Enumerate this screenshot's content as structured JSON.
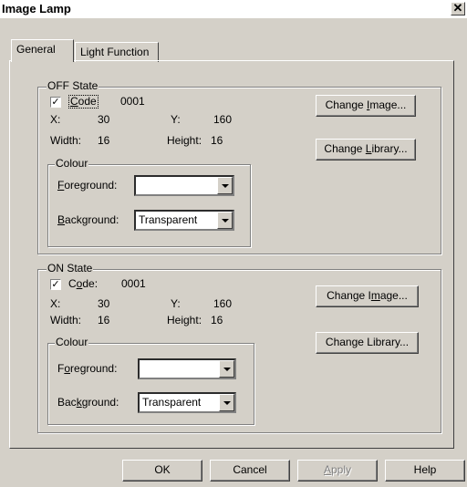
{
  "window": {
    "title": "Image Lamp",
    "close_symbol": "✕"
  },
  "tabs": [
    {
      "label": "General"
    },
    {
      "label": "Light Function"
    }
  ],
  "off_state": {
    "legend": "OFF State",
    "code_label": "Code",
    "code_checked": true,
    "code_value": "0001",
    "x_label": "X:",
    "x_value": "30",
    "y_label": "Y:",
    "y_value": "160",
    "width_label": "Width:",
    "width_value": "16",
    "height_label": "Height:",
    "height_value": "16",
    "colour": {
      "legend": "Colour",
      "foreground_label": "Foreground:",
      "foreground_value": "",
      "background_label": "Background:",
      "background_value": "Transparent"
    },
    "change_image": "Change Image...",
    "change_library": "Change Library..."
  },
  "on_state": {
    "legend": "ON State",
    "code_label": "Code:",
    "code_checked": true,
    "code_value": "0001",
    "x_label": "X:",
    "x_value": "30",
    "y_label": "Y:",
    "y_value": "160",
    "width_label": "Width:",
    "width_value": "16",
    "height_label": "Height:",
    "height_value": "16",
    "colour": {
      "legend": "Colour",
      "foreground_label": "Foreground:",
      "foreground_value": "",
      "background_label": "Background:",
      "background_value": "Transparent"
    },
    "change_image": "Change Image...",
    "change_library": "Change Library..."
  },
  "buttons": {
    "ok": "OK",
    "cancel": "Cancel",
    "apply": "Apply",
    "help": "Help"
  }
}
